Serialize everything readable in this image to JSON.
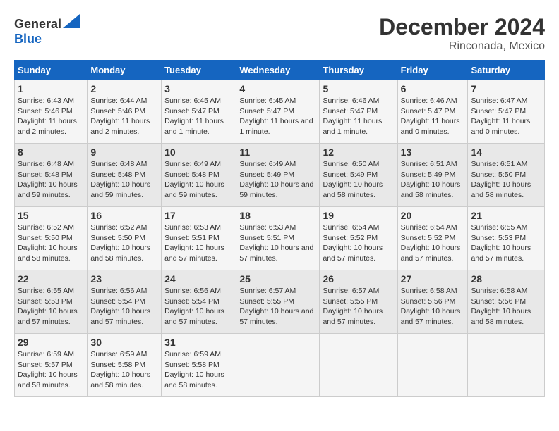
{
  "logo": {
    "text_general": "General",
    "text_blue": "Blue"
  },
  "title": "December 2024",
  "subtitle": "Rinconada, Mexico",
  "days_of_week": [
    "Sunday",
    "Monday",
    "Tuesday",
    "Wednesday",
    "Thursday",
    "Friday",
    "Saturday"
  ],
  "weeks": [
    [
      {
        "day": "1",
        "sunrise": "6:43 AM",
        "sunset": "5:46 PM",
        "daylight": "11 hours and 2 minutes."
      },
      {
        "day": "2",
        "sunrise": "6:44 AM",
        "sunset": "5:46 PM",
        "daylight": "11 hours and 2 minutes."
      },
      {
        "day": "3",
        "sunrise": "6:45 AM",
        "sunset": "5:47 PM",
        "daylight": "11 hours and 1 minute."
      },
      {
        "day": "4",
        "sunrise": "6:45 AM",
        "sunset": "5:47 PM",
        "daylight": "11 hours and 1 minute."
      },
      {
        "day": "5",
        "sunrise": "6:46 AM",
        "sunset": "5:47 PM",
        "daylight": "11 hours and 1 minute."
      },
      {
        "day": "6",
        "sunrise": "6:46 AM",
        "sunset": "5:47 PM",
        "daylight": "11 hours and 0 minutes."
      },
      {
        "day": "7",
        "sunrise": "6:47 AM",
        "sunset": "5:47 PM",
        "daylight": "11 hours and 0 minutes."
      }
    ],
    [
      {
        "day": "8",
        "sunrise": "6:48 AM",
        "sunset": "5:48 PM",
        "daylight": "10 hours and 59 minutes."
      },
      {
        "day": "9",
        "sunrise": "6:48 AM",
        "sunset": "5:48 PM",
        "daylight": "10 hours and 59 minutes."
      },
      {
        "day": "10",
        "sunrise": "6:49 AM",
        "sunset": "5:48 PM",
        "daylight": "10 hours and 59 minutes."
      },
      {
        "day": "11",
        "sunrise": "6:49 AM",
        "sunset": "5:49 PM",
        "daylight": "10 hours and 59 minutes."
      },
      {
        "day": "12",
        "sunrise": "6:50 AM",
        "sunset": "5:49 PM",
        "daylight": "10 hours and 58 minutes."
      },
      {
        "day": "13",
        "sunrise": "6:51 AM",
        "sunset": "5:49 PM",
        "daylight": "10 hours and 58 minutes."
      },
      {
        "day": "14",
        "sunrise": "6:51 AM",
        "sunset": "5:50 PM",
        "daylight": "10 hours and 58 minutes."
      }
    ],
    [
      {
        "day": "15",
        "sunrise": "6:52 AM",
        "sunset": "5:50 PM",
        "daylight": "10 hours and 58 minutes."
      },
      {
        "day": "16",
        "sunrise": "6:52 AM",
        "sunset": "5:50 PM",
        "daylight": "10 hours and 58 minutes."
      },
      {
        "day": "17",
        "sunrise": "6:53 AM",
        "sunset": "5:51 PM",
        "daylight": "10 hours and 57 minutes."
      },
      {
        "day": "18",
        "sunrise": "6:53 AM",
        "sunset": "5:51 PM",
        "daylight": "10 hours and 57 minutes."
      },
      {
        "day": "19",
        "sunrise": "6:54 AM",
        "sunset": "5:52 PM",
        "daylight": "10 hours and 57 minutes."
      },
      {
        "day": "20",
        "sunrise": "6:54 AM",
        "sunset": "5:52 PM",
        "daylight": "10 hours and 57 minutes."
      },
      {
        "day": "21",
        "sunrise": "6:55 AM",
        "sunset": "5:53 PM",
        "daylight": "10 hours and 57 minutes."
      }
    ],
    [
      {
        "day": "22",
        "sunrise": "6:55 AM",
        "sunset": "5:53 PM",
        "daylight": "10 hours and 57 minutes."
      },
      {
        "day": "23",
        "sunrise": "6:56 AM",
        "sunset": "5:54 PM",
        "daylight": "10 hours and 57 minutes."
      },
      {
        "day": "24",
        "sunrise": "6:56 AM",
        "sunset": "5:54 PM",
        "daylight": "10 hours and 57 minutes."
      },
      {
        "day": "25",
        "sunrise": "6:57 AM",
        "sunset": "5:55 PM",
        "daylight": "10 hours and 57 minutes."
      },
      {
        "day": "26",
        "sunrise": "6:57 AM",
        "sunset": "5:55 PM",
        "daylight": "10 hours and 57 minutes."
      },
      {
        "day": "27",
        "sunrise": "6:58 AM",
        "sunset": "5:56 PM",
        "daylight": "10 hours and 57 minutes."
      },
      {
        "day": "28",
        "sunrise": "6:58 AM",
        "sunset": "5:56 PM",
        "daylight": "10 hours and 58 minutes."
      }
    ],
    [
      {
        "day": "29",
        "sunrise": "6:59 AM",
        "sunset": "5:57 PM",
        "daylight": "10 hours and 58 minutes."
      },
      {
        "day": "30",
        "sunrise": "6:59 AM",
        "sunset": "5:58 PM",
        "daylight": "10 hours and 58 minutes."
      },
      {
        "day": "31",
        "sunrise": "6:59 AM",
        "sunset": "5:58 PM",
        "daylight": "10 hours and 58 minutes."
      },
      null,
      null,
      null,
      null
    ]
  ],
  "labels": {
    "sunrise": "Sunrise:",
    "sunset": "Sunset:",
    "daylight": "Daylight:"
  }
}
